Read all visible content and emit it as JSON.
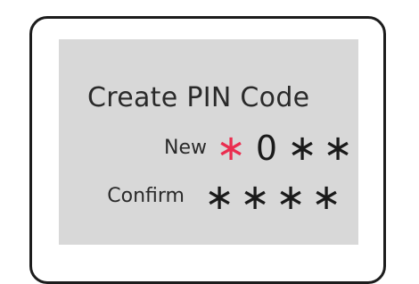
{
  "screen": {
    "title": "Create PIN Code",
    "new_label": "New",
    "confirm_label": "Confirm",
    "new_pin": [
      "*",
      "0",
      "*",
      "*"
    ],
    "confirm_pin": [
      "*",
      "*",
      "*",
      "*"
    ],
    "active_slot_index": 0
  },
  "colors": {
    "active_digit": "#ea2d4f",
    "screen_bg": "#d8d8d8",
    "frame": "#1c1c1c",
    "text": "#2a2a2a"
  }
}
